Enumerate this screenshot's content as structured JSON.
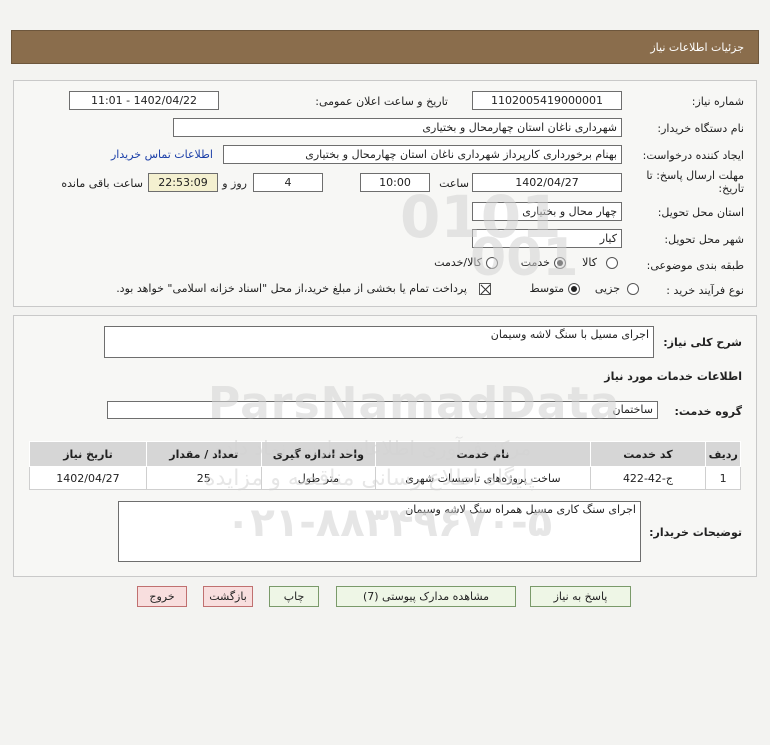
{
  "header": {
    "title": "جزئیات اطلاعات نیاز"
  },
  "form": {
    "need_number_label": "شماره نیاز:",
    "need_number": "1102005419000001",
    "announce_label": "تاریخ و ساعت اعلان عمومی:",
    "announce_value": "1402/04/22 - 11:01",
    "buyer_org_label": "نام دستگاه خریدار:",
    "buyer_org": "شهرداری ناغان استان چهارمحال و بختیاری",
    "creator_label": "ایجاد کننده درخواست:",
    "creator": "بهنام برخورداری کارپرداز شهرداری ناغان استان چهارمحال و بختیاری",
    "contact_link": "اطلاعات تماس خریدار",
    "deadline_label_line1": "مهلت ارسال پاسخ: تا",
    "deadline_label_line2": "تاریخ:",
    "deadline_date": "1402/04/27",
    "time_label": "ساعت",
    "deadline_time": "10:00",
    "days_count": "4",
    "days_label": "روز و",
    "remaining_time": "22:53:09",
    "remaining_label": "ساعت باقی مانده",
    "province_label": "استان محل تحویل:",
    "province": "چهار محال و بختیاری",
    "city_label": "شهر محل تحویل:",
    "city": "کیار",
    "category_label": "طبقه بندی موضوعی:",
    "category_options": [
      "کالا",
      "خدمت",
      "کالا/خدمت"
    ],
    "category_selected": "خدمت",
    "process_label": "نوع فرآیند خرید :",
    "process_options": [
      "جزیی",
      "متوسط"
    ],
    "process_selected": "متوسط",
    "payment_note": "پرداخت تمام یا بخشی از مبلغ خرید،از محل \"اسناد خزانه اسلامی\" خواهد بود."
  },
  "detail": {
    "summary_label": "شرح کلی نیاز:",
    "summary": "اجرای مسیل با سنگ لاشه وسیمان",
    "services_heading": "اطلاعات خدمات مورد نیاز",
    "service_group_label": "گروه خدمت:",
    "service_group": "ساختمان",
    "table": {
      "headers": [
        "ردیف",
        "کد خدمت",
        "نام خدمت",
        "واحد اندازه گیری",
        "تعداد / مقدار",
        "تاریخ نیاز"
      ],
      "rows": [
        [
          "1",
          "ج-42-422",
          "ساخت پروژه‌های تاسیسات شهری",
          "متر طول",
          "25",
          "1402/04/27"
        ]
      ]
    },
    "buyer_notes_label": "توضیحات خریدار:",
    "buyer_notes": "اجرای سنگ کاری مسیل  همراه سنگ لاشه وسیمان"
  },
  "buttons": {
    "reply": "پاسخ به نیاز",
    "attachments": "مشاهده مدارک پیوستی (7)",
    "print": "چاپ",
    "back": "بازگشت",
    "exit": "خروج"
  },
  "watermark": {
    "digits": "0101",
    "digits2": "001",
    "brand": "ParsNamadData",
    "phone": "۰۲۱-۸۸۳۴۹۶۷۰-۵",
    "line1": "مرکز فرآوری اطلاعات پارس نماد داده",
    "line2": "پایگاه اطلاع رسانی مناقصه و مزایده"
  },
  "colors": {
    "header_bg": "#8a6d4c",
    "button_green_border": "#7a9a6a",
    "button_red_border": "#c07070",
    "link": "#1b3fa8"
  }
}
